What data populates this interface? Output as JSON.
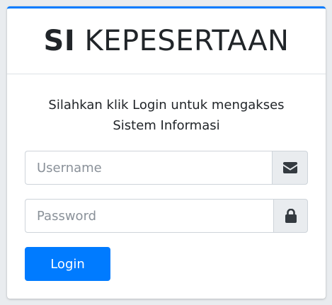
{
  "header": {
    "brand_bold": "SI",
    "brand_light": "KEPESERTAAN"
  },
  "login": {
    "message_line1": "Silahkan klik Login untuk mengakses",
    "message_line2": "Sistem Informasi",
    "username_placeholder": "Username",
    "username_value": "",
    "username_icon": "envelope-icon",
    "password_placeholder": "Password",
    "password_value": "",
    "password_icon": "lock-icon",
    "submit_label": "Login"
  },
  "colors": {
    "accent": "#007bff",
    "icon": "#343a40",
    "addon_bg": "#e9ecef"
  }
}
